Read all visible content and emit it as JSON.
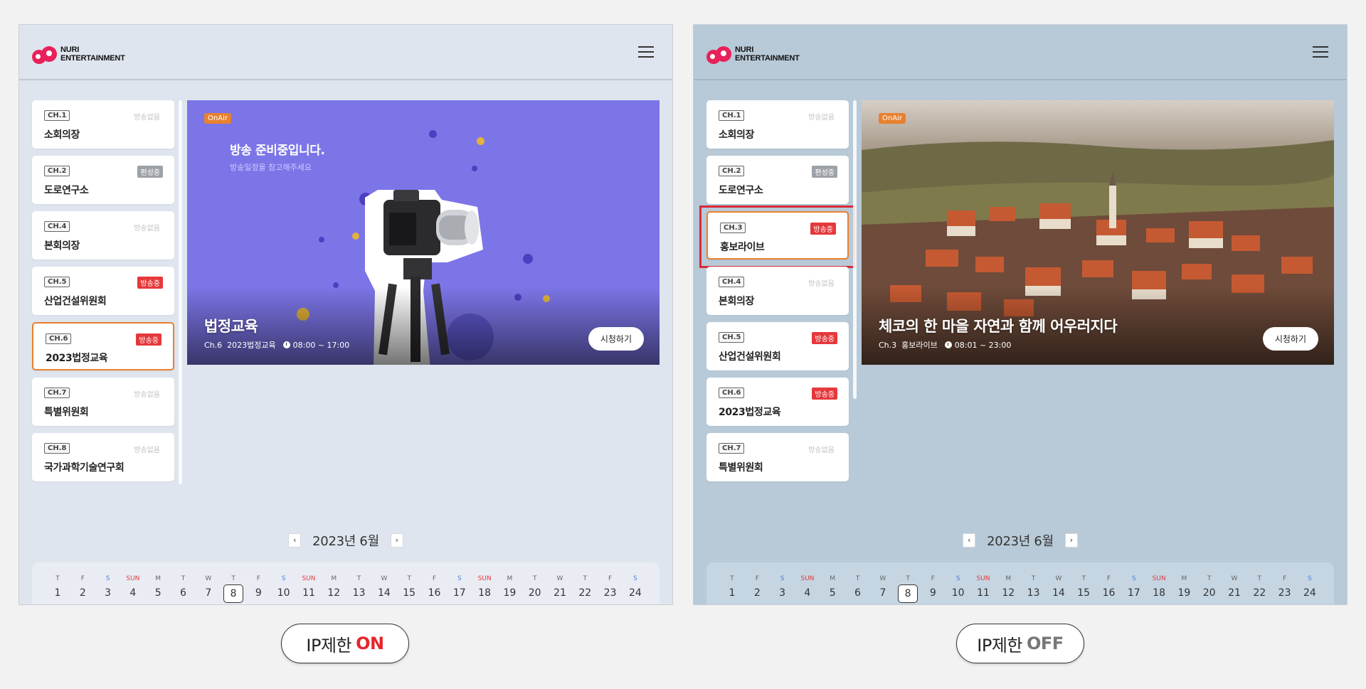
{
  "logo": {
    "line1": "NURI",
    "line2": "ENTERTAINMENT"
  },
  "left_panel": {
    "channels": [
      {
        "tag": "CH.1",
        "name": "소회의장",
        "status": "방송없음",
        "status_type": "none"
      },
      {
        "tag": "CH.2",
        "name": "도로연구소",
        "status": "편성중",
        "status_type": "edit"
      },
      {
        "tag": "CH.4",
        "name": "본회의장",
        "status": "방송없음",
        "status_type": "none"
      },
      {
        "tag": "CH.5",
        "name": "산업건설위원회",
        "status": "방송중",
        "status_type": "on"
      },
      {
        "tag": "CH.6",
        "name": "2023법정교육",
        "status": "방송중",
        "status_type": "on",
        "active": true
      },
      {
        "tag": "CH.7",
        "name": "특별위원회",
        "status": "방송없음",
        "status_type": "none"
      },
      {
        "tag": "CH.8",
        "name": "국가과학기술연구회",
        "status": "방송없음",
        "status_type": "none"
      }
    ],
    "video": {
      "badge": "OnAir",
      "prep_title": "방송 준비중입니다.",
      "prep_subtitle": "방송일정을 참고해주세요",
      "title": "법정교육",
      "channel": "Ch.6",
      "program": "2023법정교육",
      "time": "08:00 ~ 17:00",
      "watch_label": "시청하기"
    }
  },
  "right_panel": {
    "channels": [
      {
        "tag": "CH.1",
        "name": "소회의장",
        "status": "방송없음",
        "status_type": "none"
      },
      {
        "tag": "CH.2",
        "name": "도로연구소",
        "status": "편성중",
        "status_type": "edit"
      },
      {
        "tag": "CH.3",
        "name": "홍보라이브",
        "status": "방송중",
        "status_type": "on",
        "active": true
      },
      {
        "tag": "CH.4",
        "name": "본회의장",
        "status": "방송없음",
        "status_type": "none"
      },
      {
        "tag": "CH.5",
        "name": "산업건설위원회",
        "status": "방송중",
        "status_type": "on"
      },
      {
        "tag": "CH.6",
        "name": "2023법정교육",
        "status": "방송중",
        "status_type": "on"
      },
      {
        "tag": "CH.7",
        "name": "특별위원회",
        "status": "방송없음",
        "status_type": "none"
      }
    ],
    "video": {
      "badge": "OnAir",
      "title": "체코의 한 마을 자연과 함께 어우러지다",
      "channel": "Ch.3",
      "program": "홍보라이브",
      "time": "08:01 ~ 23:00",
      "watch_label": "시청하기"
    }
  },
  "calendar": {
    "title": "2023년 6월",
    "prev_icon": "chevron-left-icon",
    "next_icon": "chevron-right-icon",
    "selected_day": 8,
    "days": [
      {
        "w": "T",
        "d": "1"
      },
      {
        "w": "F",
        "d": "2"
      },
      {
        "w": "S",
        "d": "3",
        "t": "sat"
      },
      {
        "w": "SUN",
        "d": "4",
        "t": "sun"
      },
      {
        "w": "M",
        "d": "5"
      },
      {
        "w": "T",
        "d": "6"
      },
      {
        "w": "W",
        "d": "7"
      },
      {
        "w": "T",
        "d": "8"
      },
      {
        "w": "F",
        "d": "9"
      },
      {
        "w": "S",
        "d": "10",
        "t": "sat"
      },
      {
        "w": "SUN",
        "d": "11",
        "t": "sun"
      },
      {
        "w": "M",
        "d": "12"
      },
      {
        "w": "T",
        "d": "13"
      },
      {
        "w": "W",
        "d": "14"
      },
      {
        "w": "T",
        "d": "15"
      },
      {
        "w": "F",
        "d": "16"
      },
      {
        "w": "S",
        "d": "17",
        "t": "sat"
      },
      {
        "w": "SUN",
        "d": "18",
        "t": "sun"
      },
      {
        "w": "M",
        "d": "19"
      },
      {
        "w": "T",
        "d": "20"
      },
      {
        "w": "W",
        "d": "21"
      },
      {
        "w": "T",
        "d": "22"
      },
      {
        "w": "F",
        "d": "23"
      },
      {
        "w": "S",
        "d": "24",
        "t": "sat"
      }
    ]
  },
  "toggles": {
    "left": {
      "prefix": "IP제한",
      "state": "ON"
    },
    "right": {
      "prefix": "IP제한",
      "state": "OFF"
    }
  },
  "colors": {
    "accent_orange": "#e8812f",
    "on_red": "#e5262b",
    "brand_pink": "#e8215a",
    "purple": "#7c75e8"
  }
}
